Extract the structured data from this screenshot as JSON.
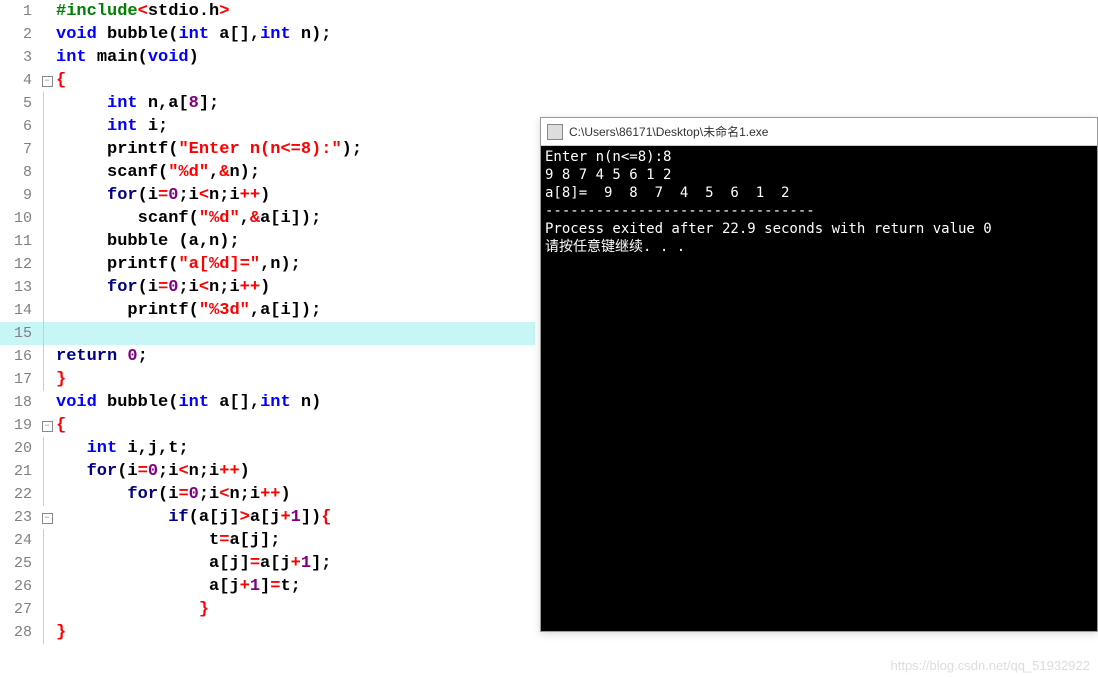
{
  "editor": {
    "lines": [
      {
        "n": "1",
        "fold": "",
        "html": "<span class='c-pre'>#include</span><span class='c-op'>&lt;</span><span class='c-plain'>stdio</span><span class='c-plain'>.</span><span class='c-plain'>h</span><span class='c-op'>&gt;</span>"
      },
      {
        "n": "2",
        "fold": "",
        "html": "<span class='c-type'>void</span> <span class='c-plain'>bubble</span><span class='c-plain'>(</span><span class='c-type'>int</span> <span class='c-plain'>a</span><span class='c-plain'>[],</span><span class='c-type'>int</span> <span class='c-plain'>n</span><span class='c-plain'>);</span>"
      },
      {
        "n": "3",
        "fold": "",
        "html": "<span class='c-type'>int</span> <span class='c-plain'>main</span><span class='c-plain'>(</span><span class='c-type'>void</span><span class='c-plain'>)</span>"
      },
      {
        "n": "4",
        "fold": "box",
        "html": "<span class='c-brace'>{</span>"
      },
      {
        "n": "5",
        "fold": "line",
        "html": "     <span class='c-type'>int</span> <span class='c-plain'>n</span><span class='c-plain'>,</span><span class='c-plain'>a</span><span class='c-plain'>[</span><span class='c-num'>8</span><span class='c-plain'>];</span>"
      },
      {
        "n": "6",
        "fold": "line",
        "html": "     <span class='c-type'>int</span> <span class='c-plain'>i</span><span class='c-plain'>;</span>"
      },
      {
        "n": "7",
        "fold": "line",
        "html": "     <span class='c-plain'>printf</span><span class='c-plain'>(</span><span class='c-str'>\"Enter n(n&lt;=8):\"</span><span class='c-plain'>);</span>"
      },
      {
        "n": "8",
        "fold": "line",
        "html": "     <span class='c-plain'>scanf</span><span class='c-plain'>(</span><span class='c-str'>\"%d\"</span><span class='c-plain'>,</span><span class='c-op'>&amp;</span><span class='c-plain'>n</span><span class='c-plain'>);</span>"
      },
      {
        "n": "9",
        "fold": "line",
        "html": "     <span class='c-kw'>for</span><span class='c-plain'>(</span><span class='c-plain'>i</span><span class='c-op'>=</span><span class='c-num'>0</span><span class='c-plain'>;</span><span class='c-plain'>i</span><span class='c-op'>&lt;</span><span class='c-plain'>n</span><span class='c-plain'>;</span><span class='c-plain'>i</span><span class='c-op'>++</span><span class='c-plain'>)</span>"
      },
      {
        "n": "10",
        "fold": "line",
        "html": "        <span class='c-plain'>scanf</span><span class='c-plain'>(</span><span class='c-str'>\"%d\"</span><span class='c-plain'>,</span><span class='c-op'>&amp;</span><span class='c-plain'>a</span><span class='c-plain'>[</span><span class='c-plain'>i</span><span class='c-plain'>]);</span>"
      },
      {
        "n": "11",
        "fold": "line",
        "html": "     <span class='c-plain'>bubble</span> <span class='c-plain'>(</span><span class='c-plain'>a</span><span class='c-plain'>,</span><span class='c-plain'>n</span><span class='c-plain'>);</span>"
      },
      {
        "n": "12",
        "fold": "line",
        "html": "     <span class='c-plain'>printf</span><span class='c-plain'>(</span><span class='c-str'>\"a[%d]=\"</span><span class='c-plain'>,</span><span class='c-plain'>n</span><span class='c-plain'>);</span>"
      },
      {
        "n": "13",
        "fold": "line",
        "html": "     <span class='c-kw'>for</span><span class='c-plain'>(</span><span class='c-plain'>i</span><span class='c-op'>=</span><span class='c-num'>0</span><span class='c-plain'>;</span><span class='c-plain'>i</span><span class='c-op'>&lt;</span><span class='c-plain'>n</span><span class='c-plain'>;</span><span class='c-plain'>i</span><span class='c-op'>++</span><span class='c-plain'>)</span>"
      },
      {
        "n": "14",
        "fold": "line",
        "html": "       <span class='c-plain'>printf</span><span class='c-plain'>(</span><span class='c-str'>\"%3d\"</span><span class='c-plain'>,</span><span class='c-plain'>a</span><span class='c-plain'>[</span><span class='c-plain'>i</span><span class='c-plain'>]);</span>"
      },
      {
        "n": "15",
        "fold": "line",
        "html": "",
        "hl": true
      },
      {
        "n": "16",
        "fold": "line",
        "html": "<span class='c-kw'>return</span> <span class='c-num'>0</span><span class='c-plain'>;</span>"
      },
      {
        "n": "17",
        "fold": "end",
        "html": "<span class='c-brace'>}</span>"
      },
      {
        "n": "18",
        "fold": "",
        "html": "<span class='c-type'>void</span> <span class='c-plain'>bubble</span><span class='c-plain'>(</span><span class='c-type'>int</span> <span class='c-plain'>a</span><span class='c-plain'>[],</span><span class='c-type'>int</span> <span class='c-plain'>n</span><span class='c-plain'>)</span>"
      },
      {
        "n": "19",
        "fold": "box",
        "html": "<span class='c-brace'>{</span>"
      },
      {
        "n": "20",
        "fold": "line",
        "html": "   <span class='c-type'>int</span> <span class='c-plain'>i</span><span class='c-plain'>,</span><span class='c-plain'>j</span><span class='c-plain'>,</span><span class='c-plain'>t</span><span class='c-plain'>;</span>"
      },
      {
        "n": "21",
        "fold": "line",
        "html": "   <span class='c-kw'>for</span><span class='c-plain'>(</span><span class='c-plain'>i</span><span class='c-op'>=</span><span class='c-num'>0</span><span class='c-plain'>;</span><span class='c-plain'>i</span><span class='c-op'>&lt;</span><span class='c-plain'>n</span><span class='c-plain'>;</span><span class='c-plain'>i</span><span class='c-op'>++</span><span class='c-plain'>)</span>"
      },
      {
        "n": "22",
        "fold": "line",
        "html": "       <span class='c-kw'>for</span><span class='c-plain'>(</span><span class='c-plain'>i</span><span class='c-op'>=</span><span class='c-num'>0</span><span class='c-plain'>;</span><span class='c-plain'>i</span><span class='c-op'>&lt;</span><span class='c-plain'>n</span><span class='c-plain'>;</span><span class='c-plain'>i</span><span class='c-op'>++</span><span class='c-plain'>)</span>"
      },
      {
        "n": "23",
        "fold": "box",
        "html": "           <span class='c-kw'>if</span><span class='c-plain'>(</span><span class='c-plain'>a</span><span class='c-plain'>[</span><span class='c-plain'>j</span><span class='c-plain'>]</span><span class='c-op'>&gt;</span><span class='c-plain'>a</span><span class='c-plain'>[</span><span class='c-plain'>j</span><span class='c-op'>+</span><span class='c-num'>1</span><span class='c-plain'>])</span><span class='c-brace'>{</span>"
      },
      {
        "n": "24",
        "fold": "line",
        "html": "               <span class='c-plain'>t</span><span class='c-op'>=</span><span class='c-plain'>a</span><span class='c-plain'>[</span><span class='c-plain'>j</span><span class='c-plain'>];</span>"
      },
      {
        "n": "25",
        "fold": "line",
        "html": "               <span class='c-plain'>a</span><span class='c-plain'>[</span><span class='c-plain'>j</span><span class='c-plain'>]</span><span class='c-op'>=</span><span class='c-plain'>a</span><span class='c-plain'>[</span><span class='c-plain'>j</span><span class='c-op'>+</span><span class='c-num'>1</span><span class='c-plain'>];</span>"
      },
      {
        "n": "26",
        "fold": "line",
        "html": "               <span class='c-plain'>a</span><span class='c-plain'>[</span><span class='c-plain'>j</span><span class='c-op'>+</span><span class='c-num'>1</span><span class='c-plain'>]</span><span class='c-op'>=</span><span class='c-plain'>t</span><span class='c-plain'>;</span>"
      },
      {
        "n": "27",
        "fold": "end",
        "html": "              <span class='c-brace'>}</span>"
      },
      {
        "n": "28",
        "fold": "end",
        "html": "<span class='c-brace'>}</span>"
      }
    ]
  },
  "console": {
    "title": "C:\\Users\\86171\\Desktop\\未命名1.exe",
    "lines": [
      "Enter n(n<=8):8",
      "9 8 7 4 5 6 1 2",
      "a[8]=  9  8  7  4  5  6  1  2",
      "--------------------------------",
      "Process exited after 22.9 seconds with return value 0",
      "请按任意键继续. . ."
    ]
  },
  "watermark": "https://blog.csdn.net/qq_51932922"
}
